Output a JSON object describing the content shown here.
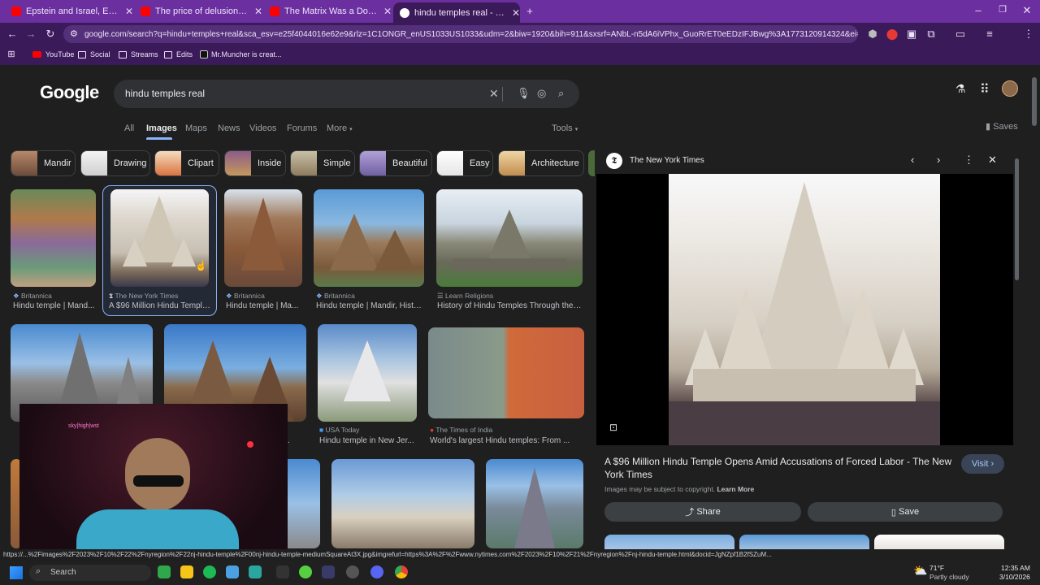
{
  "tabs": [
    {
      "title": "Epstein and Israel, Explained - Y",
      "icon": "youtube-icon",
      "color": "#ff0000"
    },
    {
      "title": "The price of delusional self-beli",
      "icon": "youtube-icon",
      "color": "#ff0000"
    },
    {
      "title": "The Matrix Was a Documentary",
      "icon": "youtube-icon",
      "color": "#ff0000"
    },
    {
      "title": "hindu temples real - Google Se",
      "icon": "google-icon",
      "color": "#ffffff"
    }
  ],
  "url": "google.com/search?q=hindu+temples+real&sca_esv=e25f4044016e62e9&rlz=1C1ONGR_enUS1033US1033&udm=2&biw=1920&bih=911&sxsrf=ANbL-n5dA6iVPhx_GuoRrET0eEDzIFJBwg%3A1773120914324&ei=kq2vaf3...",
  "bookmarks": [
    "YouTube",
    "Social",
    "Streams",
    "Edits",
    "Mr.Muncher is creat..."
  ],
  "google": {
    "logo": "Google",
    "query": "hindu temples real",
    "nav": [
      "All",
      "Images",
      "Maps",
      "News",
      "Videos",
      "Forums",
      "More",
      "Tools"
    ],
    "saves": "Saves"
  },
  "chips": [
    "Mandir",
    "Drawing",
    "Clipart",
    "Inside",
    "Simple",
    "Beautiful",
    "Easy",
    "Architecture"
  ],
  "results": [
    {
      "source": "Britannica",
      "caption": "Hindu temple | Mand..."
    },
    {
      "source": "The New York Times",
      "caption": "A $96 Million Hindu Temple..."
    },
    {
      "source": "Britannica",
      "caption": "Hindu temple | Ma..."
    },
    {
      "source": "Britannica",
      "caption": "Hindu temple | Mandir, Histo..."
    },
    {
      "source": "Learn Religions",
      "caption": "History of Hindu Temples Through the ..."
    },
    {
      "source": "USA Today",
      "caption": "Hindu temple in New Jer..."
    },
    {
      "source": "The Times of India",
      "caption": "World's largest Hindu temples: From ..."
    },
    {
      "source": "",
      "caption": "Hi"
    },
    {
      "source": "",
      "caption": "th..."
    }
  ],
  "preview": {
    "source": "The New York Times",
    "title": "A $96 Million Hindu Temple Opens Amid Accusations of Forced Labor - The New York Times",
    "copyright": "Images may be subject to copyright.",
    "learn_more": "Learn More",
    "visit": "Visit",
    "share": "Share",
    "save": "Save"
  },
  "status_url": "https://...%2Fimages%2F2023%2F10%2F22%2Fnyregion%2F22nj-hindu-temple%2F00nj-hindu-temple-mediumSquareAt3X.jpg&imgrefurl=https%3A%2F%2Fwww.nytimes.com%2F2023%2F10%2F21%2Fnyregion%2Fnj-hindu-temple.html&docid=JgNZpf1B2fSZuM...",
  "taskbar": {
    "search": "Search",
    "weather_temp": "71°F",
    "weather_desc": "Partly cloudy",
    "time": "12:35 AM",
    "date": "3/10/2026"
  },
  "webcam_sign": "sky|high|wst"
}
